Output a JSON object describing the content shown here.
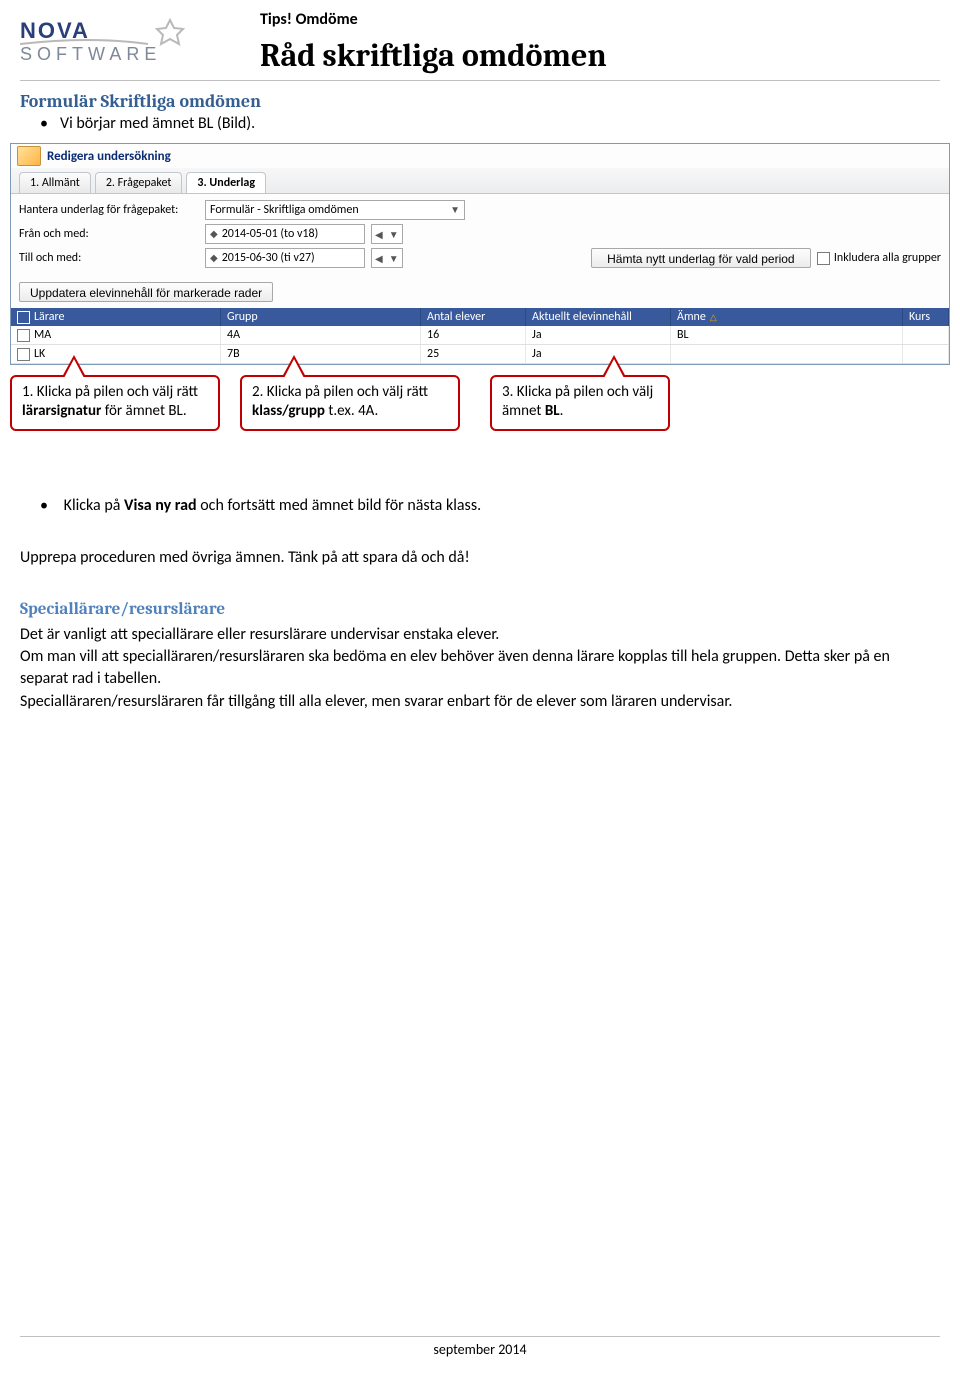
{
  "header": {
    "tips": "Tips! Omdöme",
    "title": "Råd skriftliga omdömen",
    "logo": {
      "top": "NOVA",
      "bottom": "SOFTWARE"
    }
  },
  "section": {
    "title": "Formulär Skriftliga omdömen",
    "bullet1": "Vi börjar med ämnet BL (Bild)."
  },
  "screenshot": {
    "window_title": "Redigera undersökning",
    "tabs": [
      "1. Allmänt",
      "2. Frågepaket",
      "3. Underlag"
    ],
    "active_tab_index": 2,
    "form": {
      "label_hantera": "Hantera underlag för frågepaket:",
      "combo_value": "Formulär - Skriftliga omdömen",
      "label_fran": "Från och med:",
      "fran_value": "2014-05-01 (to v18)",
      "label_till": "Till och med:",
      "till_value": "2015-06-30 (ti v27)",
      "btn_hamta": "Hämta nytt underlag för vald period",
      "chk_inkludera": "Inkludera alla grupper",
      "btn_uppdatera": "Uppdatera elevinnehåll för markerade rader"
    },
    "columns": {
      "larare": "Lärare",
      "grupp": "Grupp",
      "antal": "Antal elever",
      "aktuellt": "Aktuellt elevinnehåll",
      "amne": "Ämne",
      "kurs": "Kurs"
    },
    "rows": [
      {
        "larare": "MA",
        "grupp": "4A",
        "antal": "16",
        "aktuellt": "Ja",
        "amne": "BL",
        "kurs": ""
      },
      {
        "larare": "LK",
        "grupp": "7B",
        "antal": "25",
        "aktuellt": "Ja",
        "amne": "",
        "kurs": ""
      }
    ]
  },
  "callouts": {
    "c1_pre": "1. Klicka på pilen och välj rätt ",
    "c1_bold": "lärarsignatur",
    "c1_post": " för ämnet BL.",
    "c2_pre": "2. Klicka på pilen och välj rätt ",
    "c2_bold": "klass/grupp",
    "c2_post": " t.ex. 4A.",
    "c3_pre": "3. Klicka på pilen och välj ämnet ",
    "c3_bold": "BL",
    "c3_post": "."
  },
  "body": {
    "bullet2_pre": "Klicka på ",
    "bullet2_bold": "Visa ny rad",
    "bullet2_post": " och fortsätt med ämnet bild för nästa klass.",
    "para1": "Upprepa proceduren med övriga ämnen. Tänk på att spara då och då!",
    "subheading": "Speciallärare/resurslärare",
    "para2": "Det är vanligt att speciallärare eller resurslärare undervisar enstaka elever.",
    "para3": "Om man vill att specialläraren/resursläraren ska bedöma en elev behöver även denna lärare kopplas till hela gruppen. Detta sker på en separat rad i tabellen.",
    "para4": "Specialläraren/resursläraren får tillgång till alla elever, men svarar enbart för de elever som läraren undervisar."
  },
  "footer": {
    "text": "september 2014"
  }
}
